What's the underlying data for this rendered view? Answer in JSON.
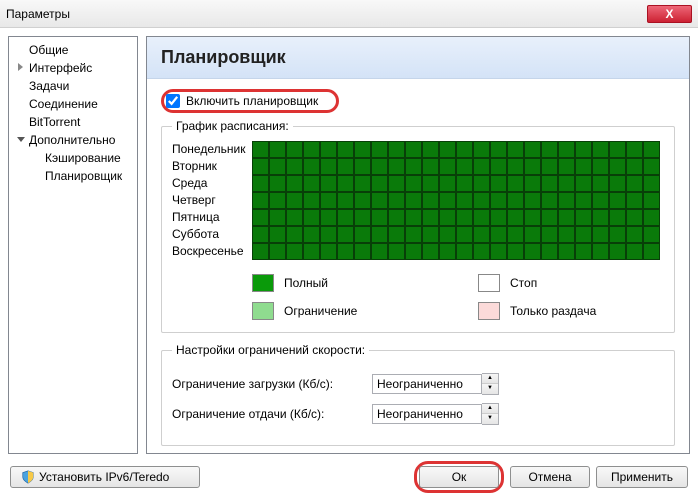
{
  "window": {
    "title": "Параметры",
    "close": "X"
  },
  "sidebar": {
    "items": [
      {
        "label": "Общие"
      },
      {
        "label": "Интерфейс"
      },
      {
        "label": "Задачи"
      },
      {
        "label": "Соединение"
      },
      {
        "label": "BitTorrent"
      },
      {
        "label": "Дополнительно"
      }
    ],
    "children": [
      {
        "label": "Кэширование"
      },
      {
        "label": "Планировщик"
      }
    ]
  },
  "header": {
    "title": "Планировщик"
  },
  "enable": {
    "label": "Включить планировщик",
    "checked": true
  },
  "schedule": {
    "legend_label": "График расписания:",
    "days": [
      "Понедельник",
      "Вторник",
      "Среда",
      "Четверг",
      "Пятница",
      "Суббота",
      "Воскресенье"
    ],
    "cols": 24
  },
  "legend": {
    "full": "Полный",
    "stop": "Стоп",
    "limit": "Ограничение",
    "seed": "Только раздача"
  },
  "speed": {
    "group_label": "Настройки ограничений скорости:",
    "download_label": "Ограничение загрузки (Кб/с):",
    "upload_label": "Ограничение отдачи (Кб/с):",
    "download_value": "Неограниченно",
    "upload_value": "Неограниченно"
  },
  "footer": {
    "ipv6": "Установить IPv6/Teredo",
    "ok": "Ок",
    "cancel": "Отмена",
    "apply": "Применить"
  }
}
